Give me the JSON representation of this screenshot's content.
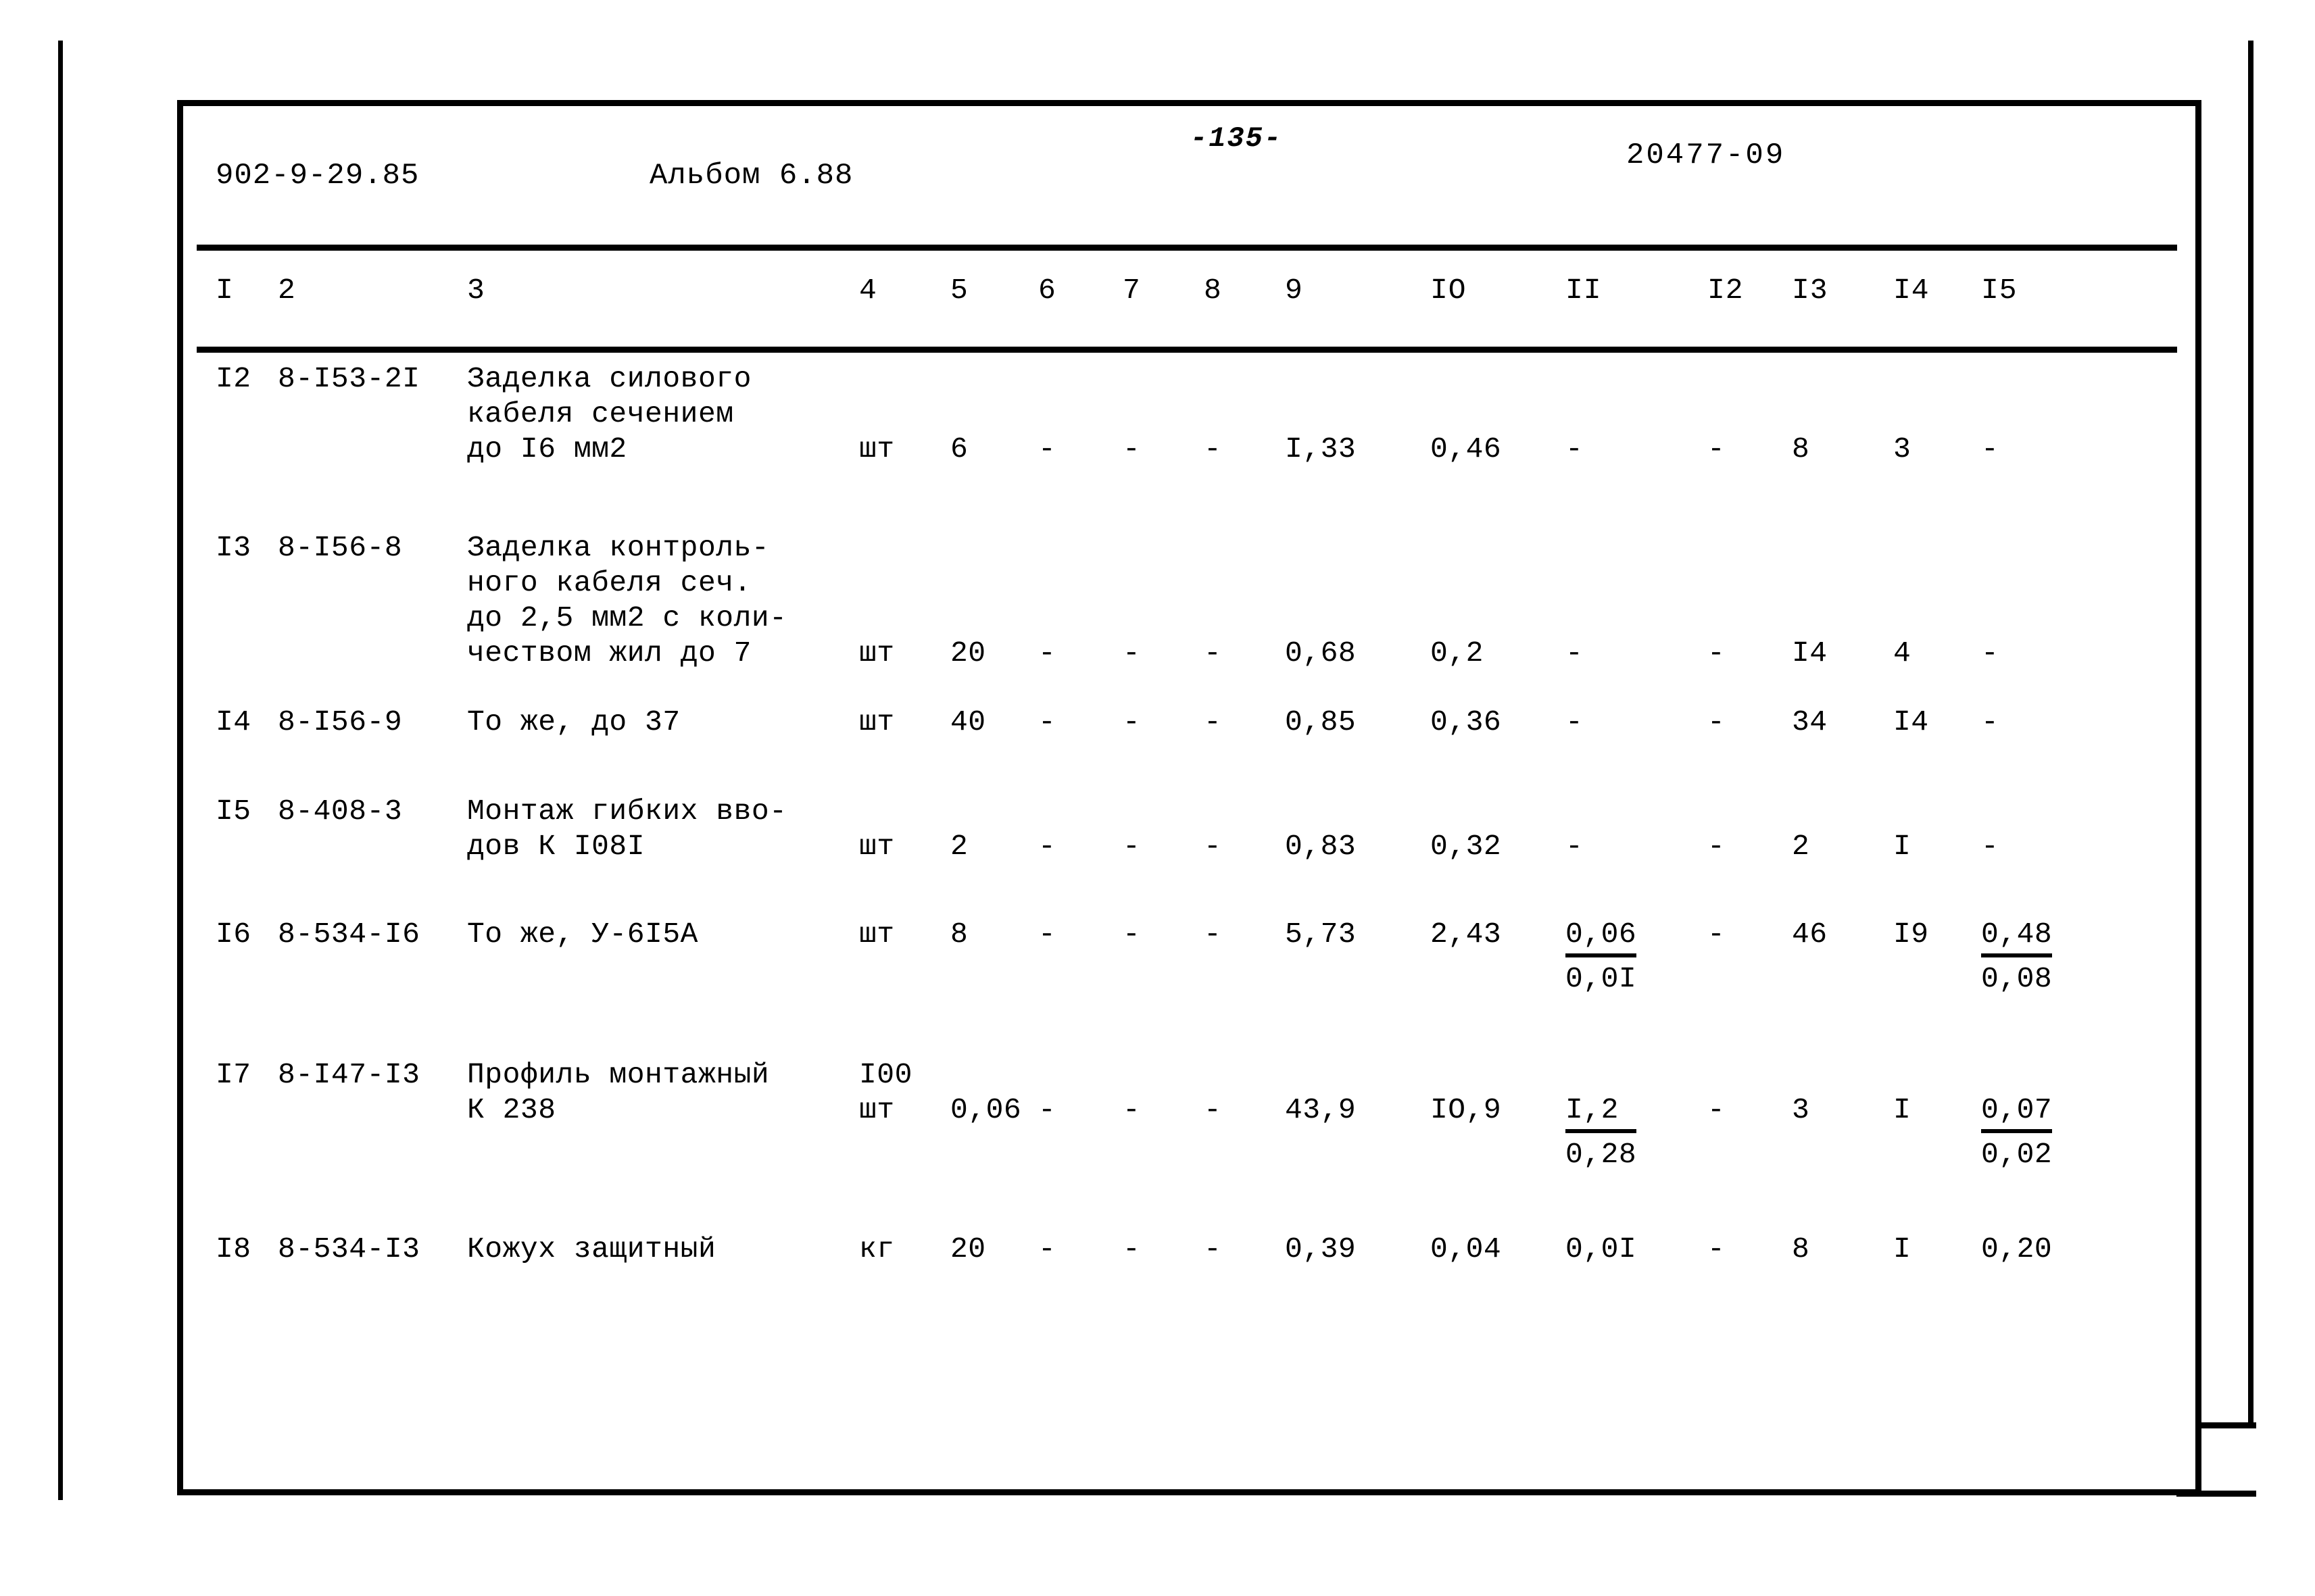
{
  "sheet": {
    "doc_code": "902-9-29.85",
    "album": "Альбом 6.88",
    "page_number": "-135-",
    "sheet_id": "20477-09"
  },
  "table": {
    "column_headers": [
      "I",
      "2",
      "3",
      "4",
      "5",
      "6",
      "7",
      "8",
      "9",
      "IO",
      "II",
      "I2",
      "I3",
      "I4",
      "I5"
    ],
    "rows": [
      {
        "pos": "I2",
        "code": "8-I53-2I",
        "description": "Заделка силового\nкабеля сечением\nдо I6 мм2",
        "unit": "шт",
        "c5": "6",
        "c6": "-",
        "c7": "-",
        "c8": "-",
        "c9": "I,33",
        "c10": "0,46",
        "c11": "-",
        "c12": "-",
        "c13": "8",
        "c14": "3",
        "c15": "-"
      },
      {
        "pos": "I3",
        "code": "8-I56-8",
        "description": "Заделка контроль-\nного кабеля сеч.\nдо 2,5 мм2 с коли-\nчеством жил до 7",
        "unit": "шт",
        "c5": "20",
        "c6": "-",
        "c7": "-",
        "c8": "-",
        "c9": "0,68",
        "c10": "0,2",
        "c11": "-",
        "c12": "-",
        "c13": "I4",
        "c14": "4",
        "c15": "-"
      },
      {
        "pos": "I4",
        "code": "8-I56-9",
        "description": "То же, до 37",
        "unit": "шт",
        "c5": "40",
        "c6": "-",
        "c7": "-",
        "c8": "-",
        "c9": "0,85",
        "c10": "0,36",
        "c11": "-",
        "c12": "-",
        "c13": "34",
        "c14": "I4",
        "c15": "-"
      },
      {
        "pos": "I5",
        "code": "8-408-3",
        "description": "Монтаж гибких вво-\nдов К I08I",
        "unit": "шт",
        "c5": "2",
        "c6": "-",
        "c7": "-",
        "c8": "-",
        "c9": "0,83",
        "c10": "0,32",
        "c11": "-",
        "c12": "-",
        "c13": "2",
        "c14": "I",
        "c15": "-"
      },
      {
        "pos": "I6",
        "code": "8-534-I6",
        "description": "То же, У-6I5А",
        "unit": "шт",
        "c5": "8",
        "c6": "-",
        "c7": "-",
        "c8": "-",
        "c9": "5,73",
        "c10": "2,43",
        "c11_num": "0,06",
        "c11_den": "0,0I",
        "c12": "-",
        "c13": "46",
        "c14": "I9",
        "c15_num": "0,48",
        "c15_den": "0,08"
      },
      {
        "pos": "I7",
        "code": "8-I47-I3",
        "description": "Профиль монтажный\nК 238",
        "unit": "I00\nшт",
        "c5": "0,06",
        "c6": "-",
        "c7": "-",
        "c8": "-",
        "c9": "43,9",
        "c10": "IO,9",
        "c11_num": "I,2",
        "c11_den": "0,28",
        "c12": "-",
        "c13": "3",
        "c14": "I",
        "c15_num": "0,07",
        "c15_den": "0,02"
      },
      {
        "pos": "I8",
        "code": "8-534-I3",
        "description": "Кожух защитный",
        "unit": "кг",
        "c5": "20",
        "c6": "-",
        "c7": "-",
        "c8": "-",
        "c9": "0,39",
        "c10": "0,04",
        "c11": "0,0I",
        "c12": "-",
        "c13": "8",
        "c14": "I",
        "c15": "0,20"
      }
    ]
  }
}
